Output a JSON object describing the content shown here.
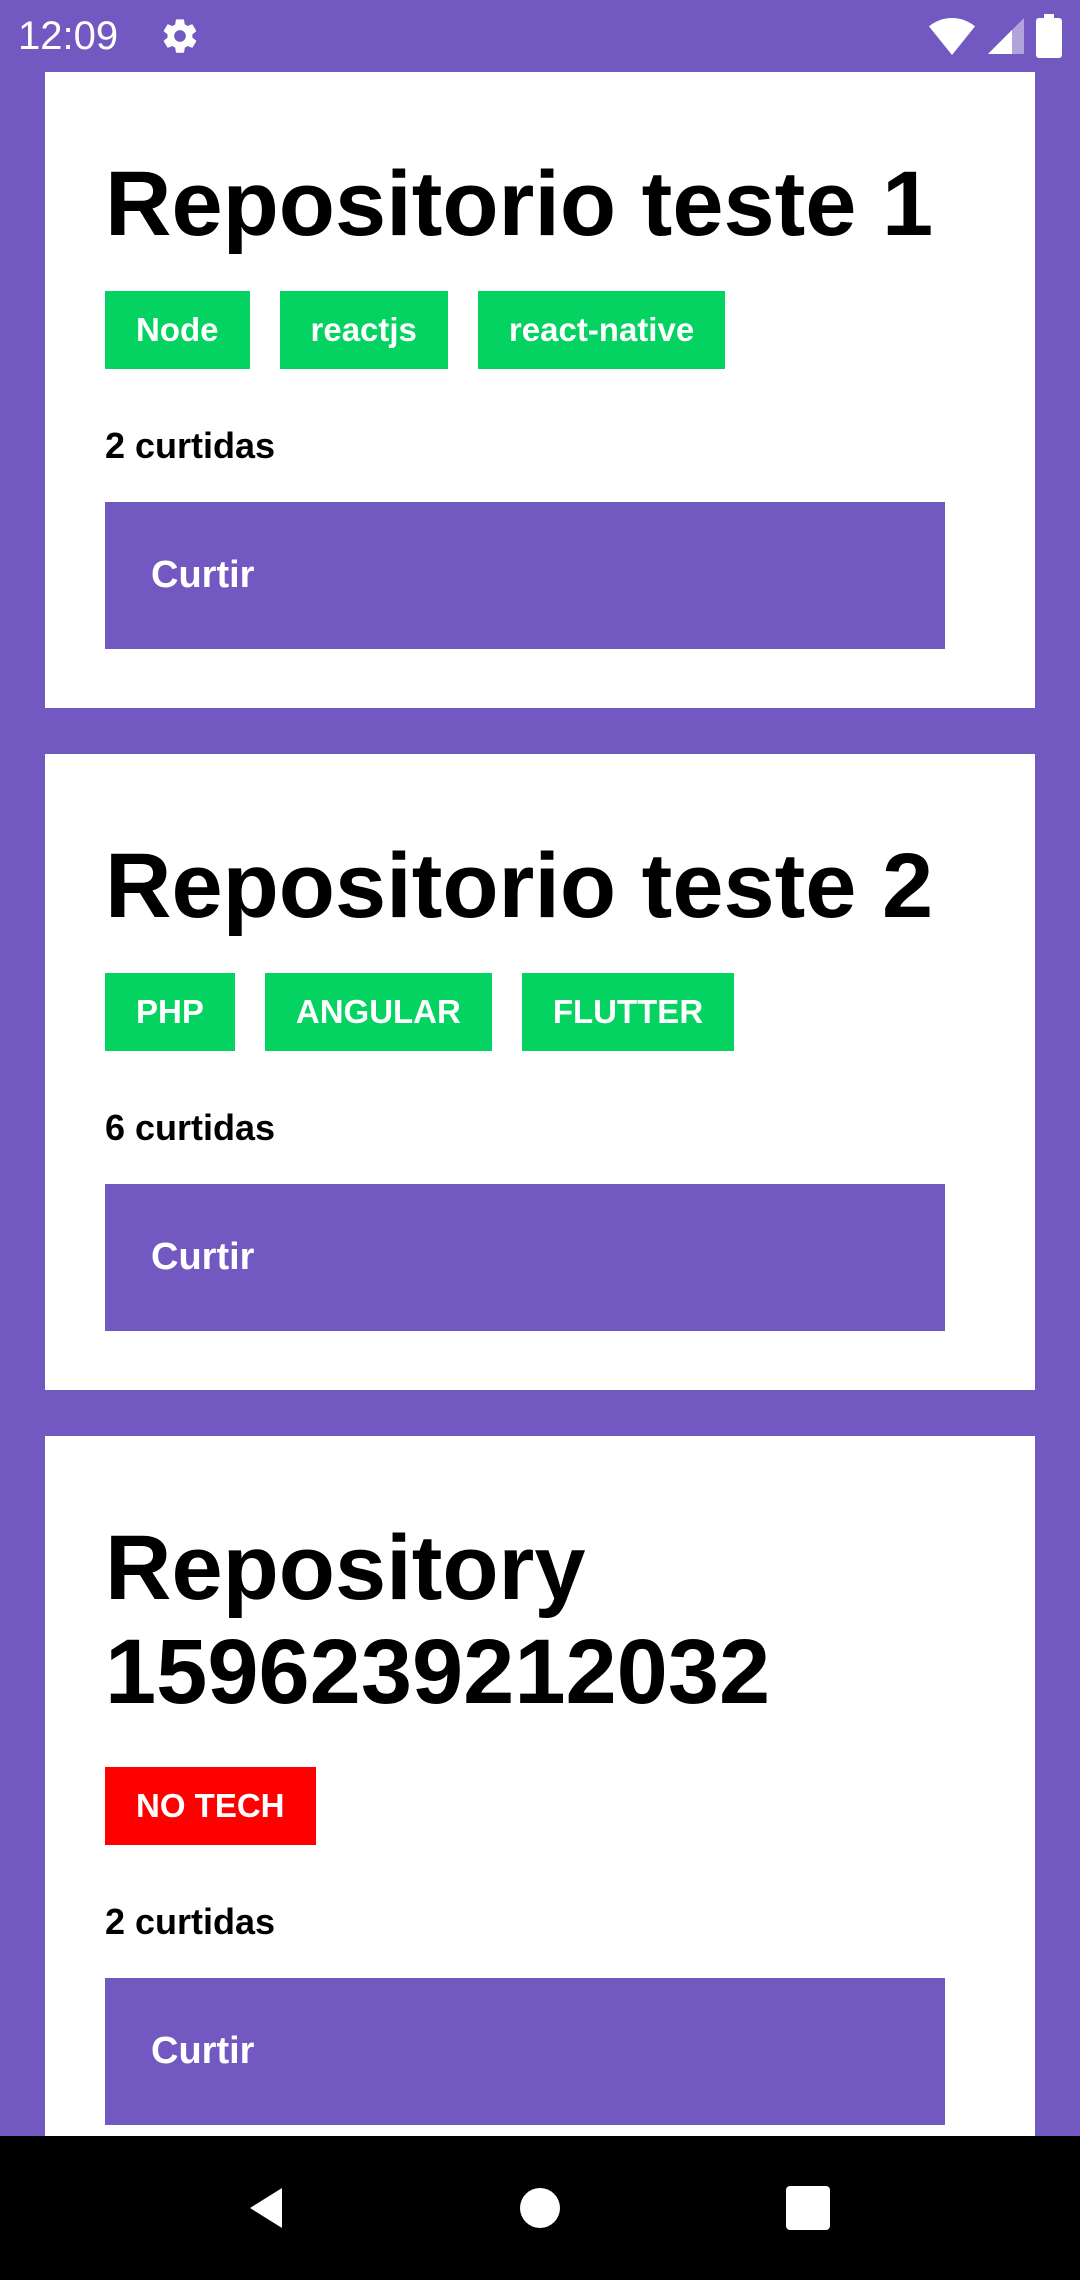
{
  "status_bar": {
    "time": "12:09",
    "icons": [
      "gear-icon",
      "wifi-icon",
      "signal-icon",
      "battery-icon"
    ]
  },
  "colors": {
    "background": "#7159c1",
    "card": "#ffffff",
    "tech_badge": "#04d361",
    "no_tech_badge": "#ff0000",
    "button": "#7159c1"
  },
  "repositories": [
    {
      "title": "Repositorio teste 1",
      "techs": [
        "Node",
        "reactjs",
        "react-native"
      ],
      "likes": "2 curtidas",
      "button_label": "Curtir"
    },
    {
      "title": "Repositorio teste 2",
      "techs": [
        "PHP",
        "ANGULAR",
        "FLUTTER"
      ],
      "likes": "6 curtidas",
      "button_label": "Curtir"
    },
    {
      "title": "Repository 1596239212032",
      "techs": [
        "NO TECH"
      ],
      "likes": "2 curtidas",
      "button_label": "Curtir"
    }
  ],
  "nav_bar": {
    "icons": [
      "back-icon",
      "home-icon",
      "recents-icon"
    ]
  }
}
